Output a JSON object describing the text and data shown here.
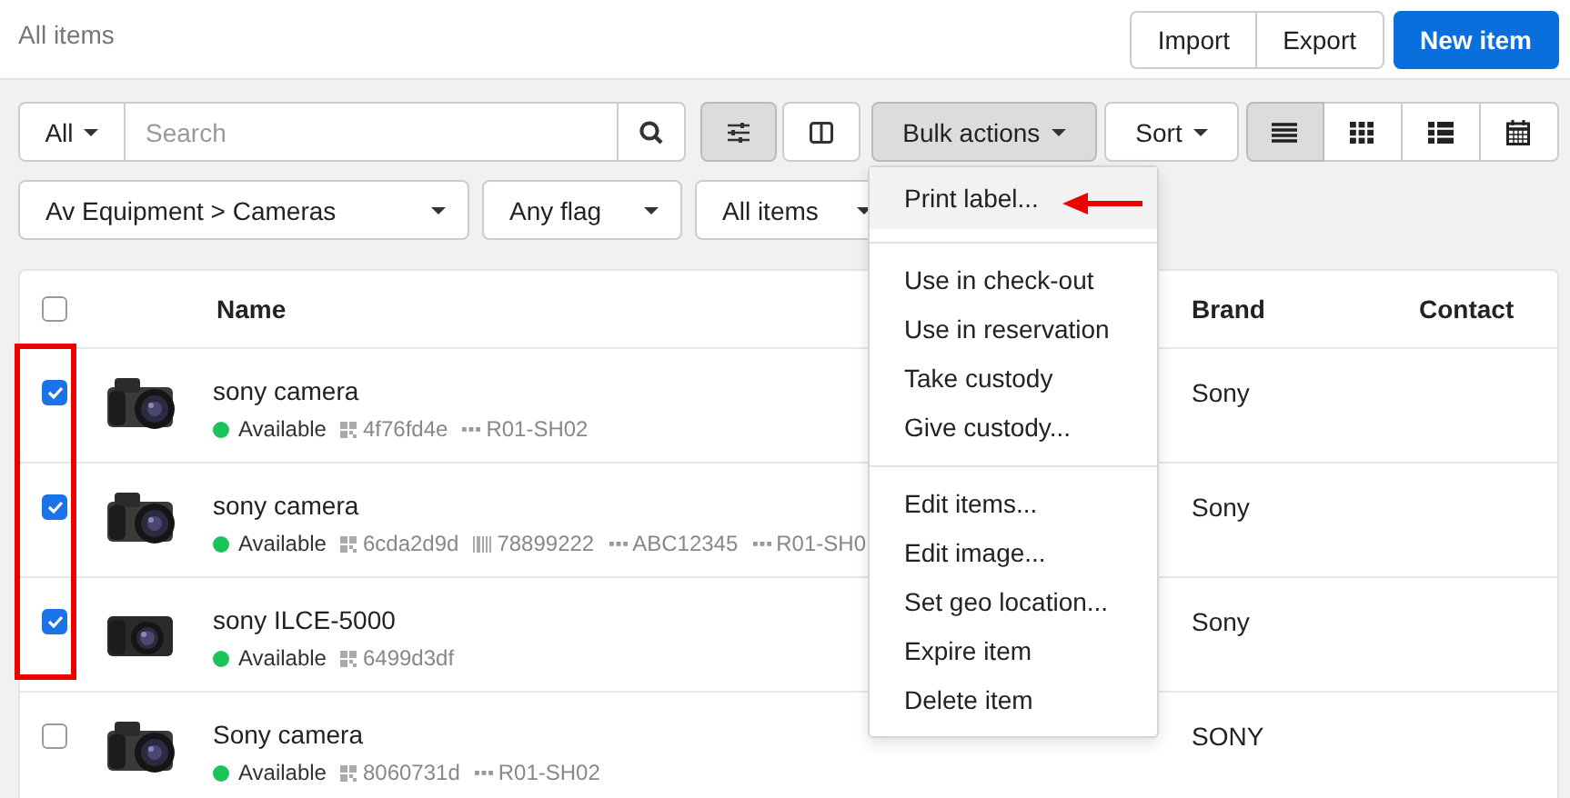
{
  "header": {
    "title": "All items",
    "buttons": [
      {
        "label": "Import",
        "kind": "default"
      },
      {
        "label": "Export",
        "kind": "default"
      },
      {
        "label": "New item",
        "kind": "primary"
      }
    ]
  },
  "toolbar": {
    "scope": "All",
    "search": {
      "placeholder": "Search"
    },
    "filter_toggle": {
      "pressed": true
    },
    "columns_toggle": {
      "pressed": false
    },
    "bulk_actions": {
      "label": "Bulk actions",
      "open": true
    },
    "sort": {
      "label": "Sort"
    },
    "views": [
      {
        "kind": "list",
        "selected": true
      },
      {
        "kind": "grid",
        "selected": false
      },
      {
        "kind": "details",
        "selected": false
      },
      {
        "kind": "calendar",
        "selected": false
      }
    ]
  },
  "filters": [
    {
      "label": "Av Equipment > Cameras"
    },
    {
      "label": "Any flag"
    },
    {
      "label": "All items"
    }
  ],
  "table": {
    "select_all": {
      "checked": false
    },
    "columns": [
      "Name",
      "Brand",
      "Contact"
    ],
    "rows": [
      {
        "checked": true,
        "name": "sony camera",
        "status": "Available",
        "color": "#1bc45a",
        "meta": [
          {
            "kind": "qr",
            "text": "4f76fd4e"
          },
          {
            "kind": "location",
            "text": "R01-SH02"
          }
        ],
        "brand": "Sony"
      },
      {
        "checked": true,
        "name": "sony camera",
        "status": "Available",
        "color": "#1bc45a",
        "meta": [
          {
            "kind": "qr",
            "text": "6cda2d9d"
          },
          {
            "kind": "barcode",
            "text": "78899222"
          },
          {
            "kind": "location",
            "text": "ABC12345"
          },
          {
            "kind": "location",
            "text": "R01-SH0"
          }
        ],
        "brand": "Sony"
      },
      {
        "checked": true,
        "name": "sony ILCE-5000",
        "status": "Available",
        "color": "#1bc45a",
        "meta": [
          {
            "kind": "qr",
            "text": "6499d3df"
          }
        ],
        "brand": "Sony"
      },
      {
        "checked": false,
        "name": "Sony camera",
        "status": "Available",
        "color": "#1bc45a",
        "meta": [
          {
            "kind": "qr",
            "text": "8060731d"
          },
          {
            "kind": "location",
            "text": "R01-SH02"
          }
        ],
        "brand": "SONY"
      }
    ]
  },
  "bulk_menu": {
    "groups": [
      [
        {
          "label": "Print label...",
          "selected": true
        }
      ],
      [
        {
          "label": "Use in check-out",
          "selected": false
        },
        {
          "label": "Use in reservation",
          "selected": false
        },
        {
          "label": "Take custody",
          "selected": false
        },
        {
          "label": "Give custody...",
          "selected": false
        }
      ],
      [
        {
          "label": "Edit items...",
          "selected": false
        },
        {
          "label": "Edit image...",
          "selected": false
        },
        {
          "label": "Set geo location...",
          "selected": false
        },
        {
          "label": "Expire item",
          "selected": false
        },
        {
          "label": "Delete item",
          "selected": false
        }
      ]
    ]
  }
}
